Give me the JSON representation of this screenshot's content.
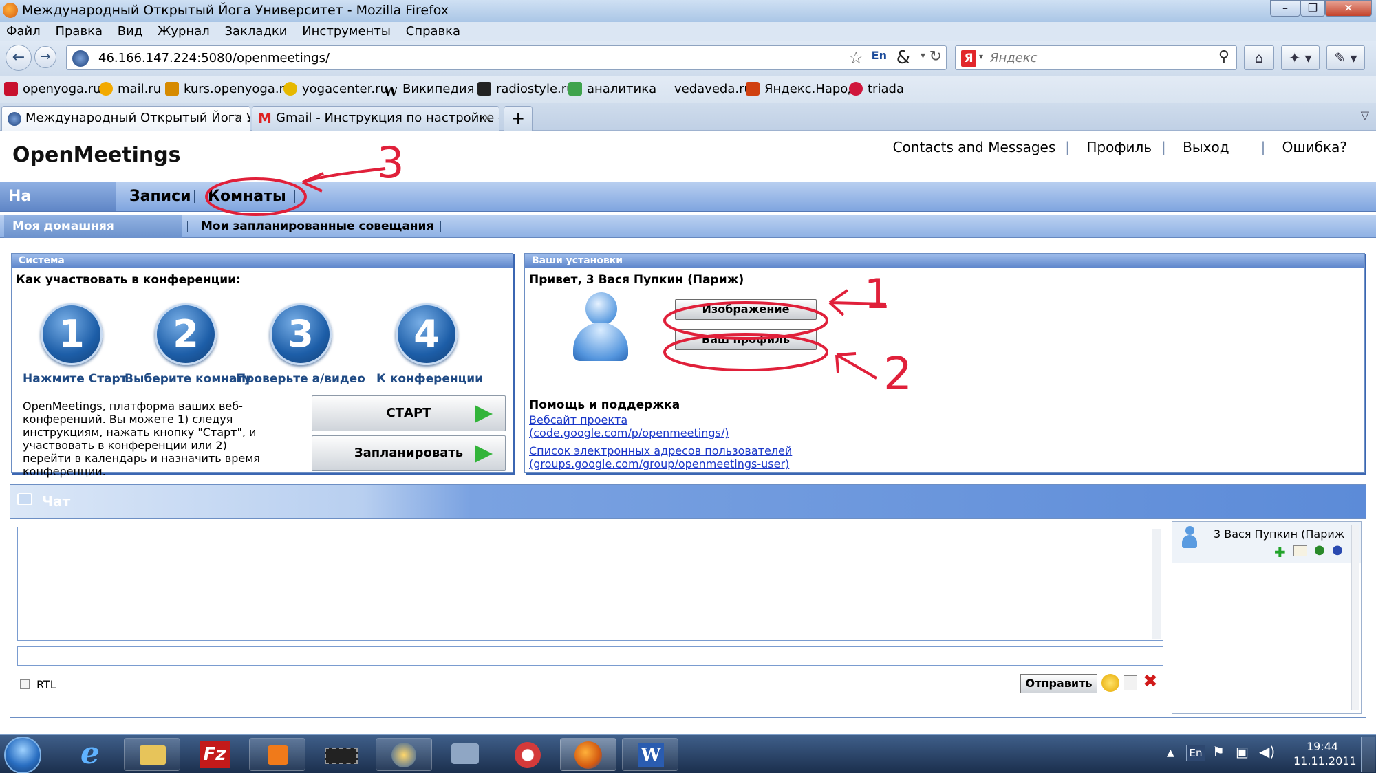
{
  "window": {
    "title": "Международный Открытый Йога Университет - Mozilla Firefox"
  },
  "menu": [
    "Файл",
    "Правка",
    "Вид",
    "Журнал",
    "Закладки",
    "Инструменты",
    "Справка"
  ],
  "navbar": {
    "url": "46.166.147.224:5080/openmeetings/",
    "search_placeholder": "Яндекс",
    "search_engine_letter": "Я"
  },
  "bookmarks": [
    {
      "label": "openyoga.ru",
      "color": "#c8102e"
    },
    {
      "label": "mail.ru",
      "color": "#f2a900"
    },
    {
      "label": "kurs.openyoga.ru",
      "color": "#d68a00"
    },
    {
      "label": "yogacenter.ru",
      "color": "#e6b800"
    },
    {
      "label": "Википедия",
      "color": "#ffffff"
    },
    {
      "label": "radiostyle.ru",
      "color": "#222222"
    },
    {
      "label": "аналитика",
      "color": "#3fa34d"
    },
    {
      "label": "vedaveda.ru",
      "color": "#ffffff"
    },
    {
      "label": "Яндекс.Народ",
      "color": "#d04010"
    },
    {
      "label": "triada",
      "color": "#d0163c"
    }
  ],
  "tabs": [
    {
      "label": "Международный Открытый Йога У...",
      "active": true
    },
    {
      "label": "Gmail - Инструкция по настройке - ...",
      "active": false
    }
  ],
  "app": {
    "brand": "OpenMeetings",
    "top_links": [
      "Contacts and Messages",
      "Профиль",
      "Выход",
      "Ошибка?"
    ],
    "main_nav": [
      "На главную",
      "Записи",
      "Комнаты"
    ],
    "sub_nav": [
      "Моя домашняя страница",
      "Мои запланированные совещания"
    ],
    "system_panel": {
      "header": "Система",
      "heading": "Как участвовать в конференции:",
      "steps": [
        {
          "num": "1",
          "label": "Нажмите Старт"
        },
        {
          "num": "2",
          "label": "Выберите комнату"
        },
        {
          "num": "3",
          "label": "Проверьте а/видео"
        },
        {
          "num": "4",
          "label": "К конференции"
        }
      ],
      "description": "OpenMeetings, платформа ваших веб-конференций. Вы можете 1) следуя инструкциям, нажать кнопку \"Старт\", и участвовать в конференции или 2) перейти в календарь и назначить время конференции.",
      "start_label": "СТАРТ",
      "schedule_label": "Запланировать"
    },
    "settings_panel": {
      "header": "Ваши установки",
      "greeting": "Привет, 3 Вася Пупкин (Париж)",
      "image_button": "Изображение",
      "profile_button": "Ваш профиль",
      "help_heading": "Помощь и поддержка",
      "link1_line1": "Вебсайт проекта",
      "link1_line2": "(code.google.com/p/openmeetings/)",
      "link2_line1": "Список электронных адресов пользователей",
      "link2_line2": "(groups.google.com/group/openmeetings-user)"
    },
    "chat": {
      "title": "Чат",
      "rtl_label": "RTL",
      "send_label": "Отправить",
      "user_name": "3 Вася Пупкин (Париж"
    }
  },
  "annotations": {
    "label1": "1",
    "label2": "2",
    "label3": "3"
  },
  "taskbar": {
    "lang": "En",
    "time": "19:44",
    "date": "11.11.2011"
  }
}
